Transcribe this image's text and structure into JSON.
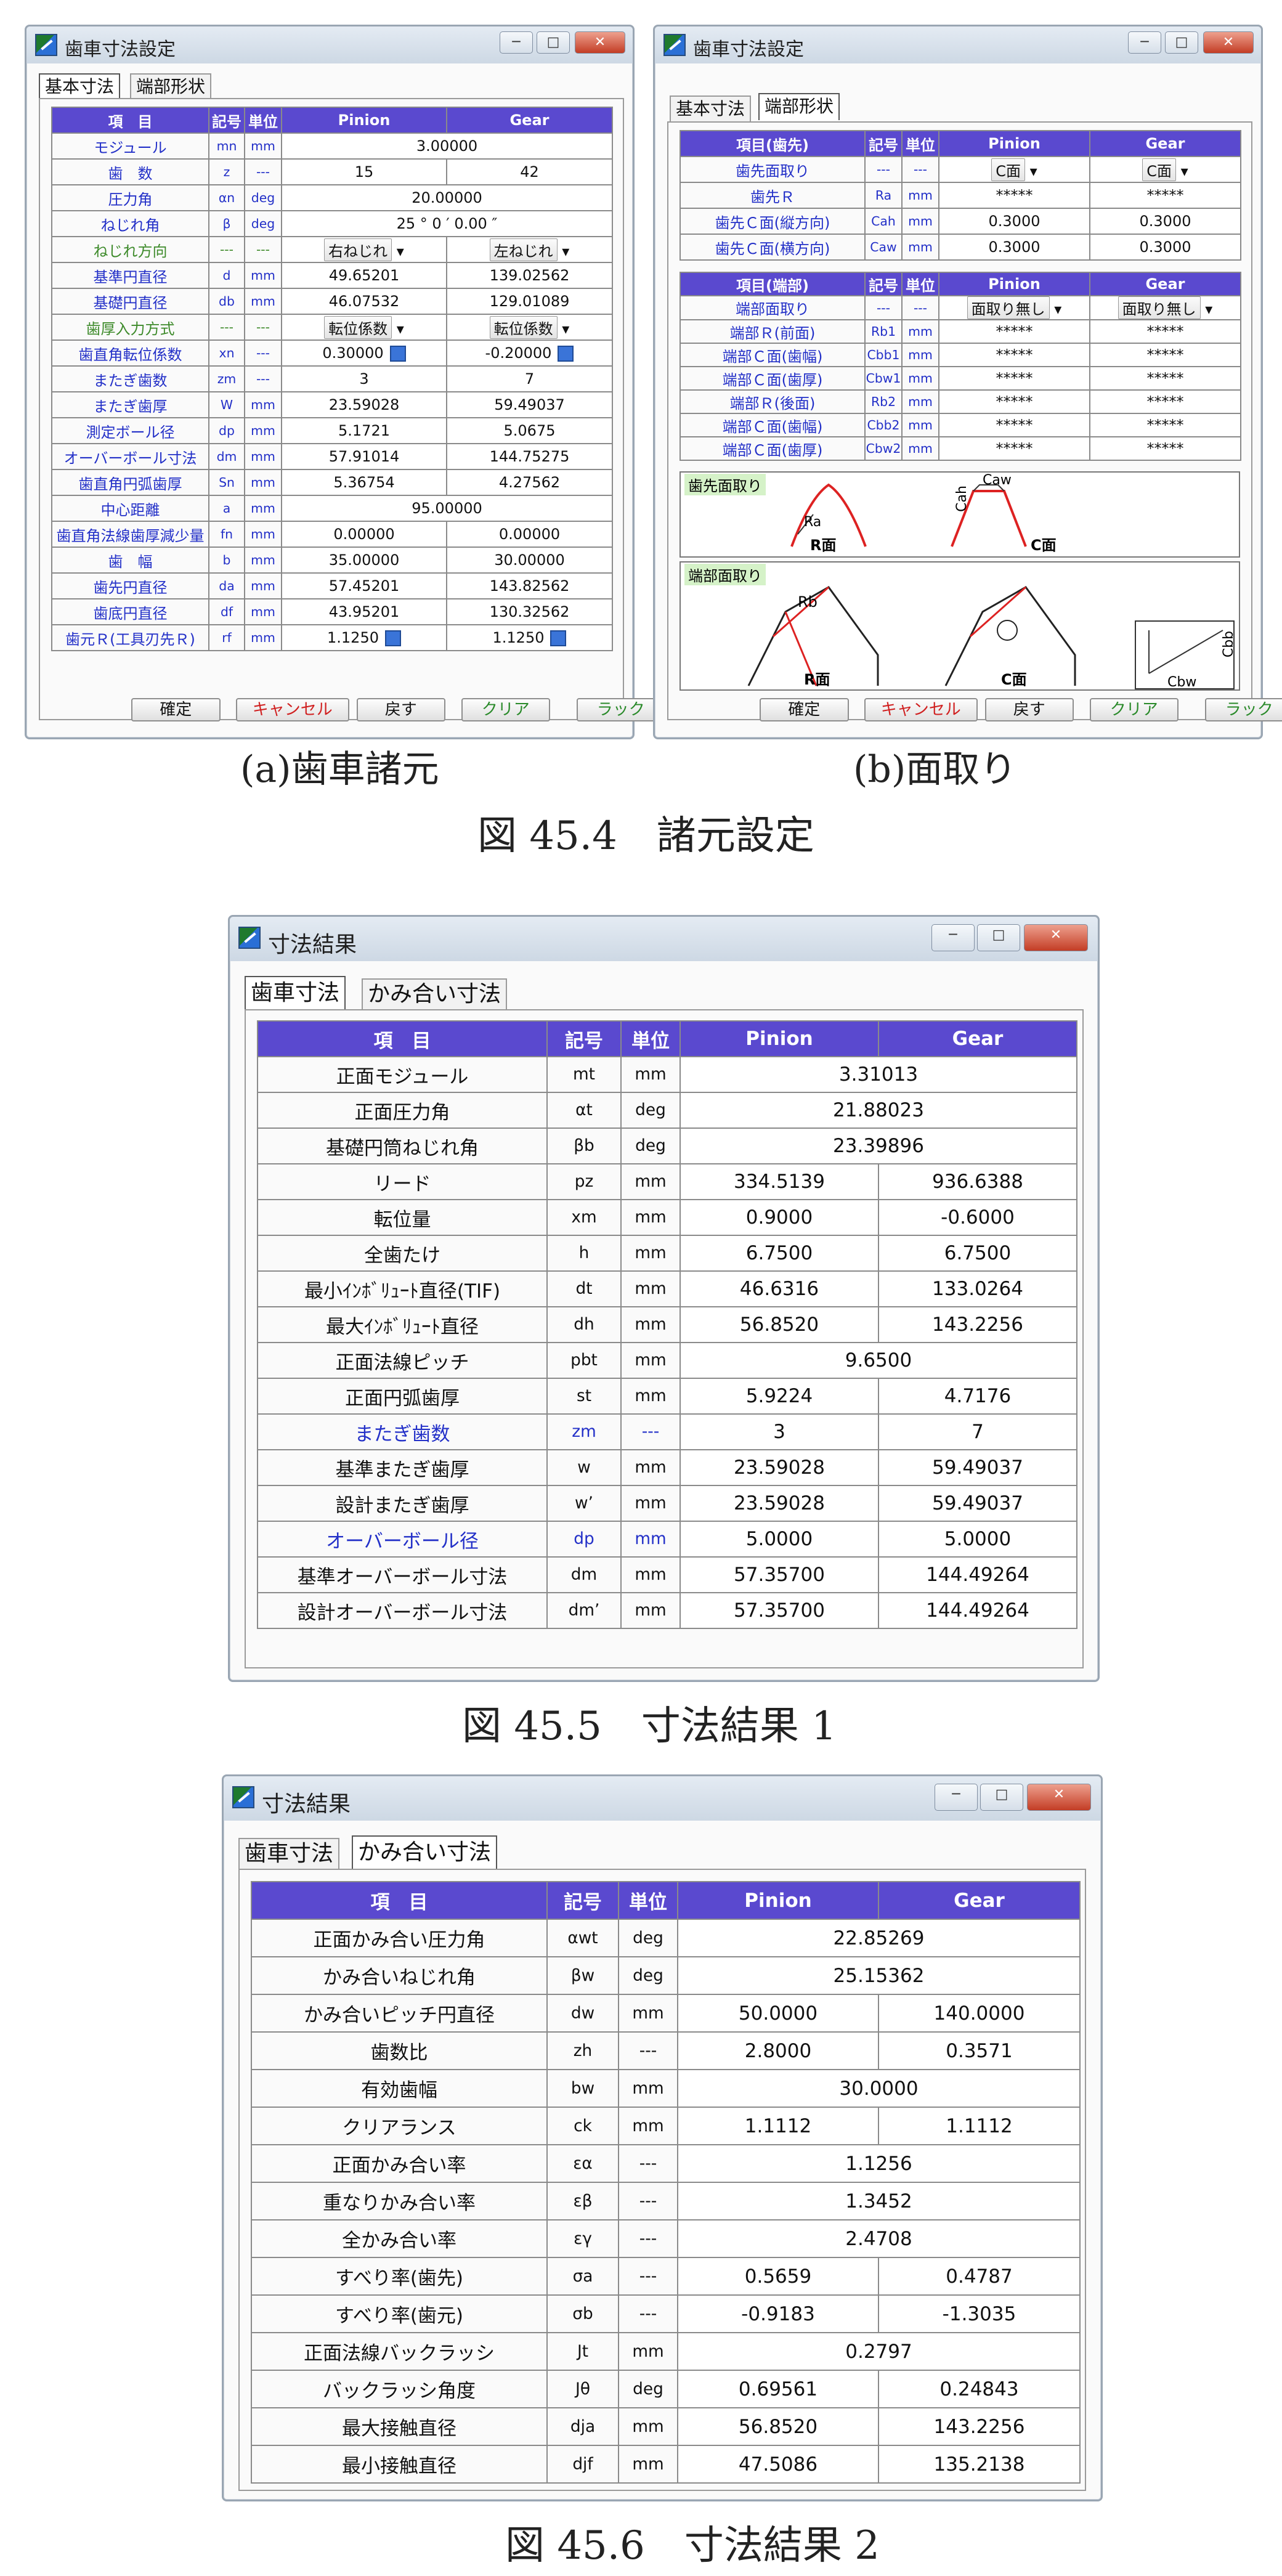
{
  "win_a": {
    "title": "歯車寸法設定",
    "tabs": [
      "基本寸法",
      "端部形状"
    ],
    "headers": [
      "項　目",
      "記号",
      "単位",
      "Pinion",
      "Gear"
    ],
    "rows": [
      [
        "モジュール",
        "mn",
        "mm",
        "3.00000",
        ""
      ],
      [
        "歯　数",
        "z",
        "---",
        "15",
        "42"
      ],
      [
        "圧力角",
        "αn",
        "deg",
        "20.00000",
        ""
      ],
      [
        "ねじれ角",
        "β",
        "deg",
        "25 ° 0 ′ 0.00 ″",
        ""
      ],
      [
        "ねじれ方向",
        "---",
        "---",
        "右ねじれ",
        "左ねじれ"
      ],
      [
        "基準円直径",
        "d",
        "mm",
        "49.65201",
        "139.02562"
      ],
      [
        "基礎円直径",
        "db",
        "mm",
        "46.07532",
        "129.01089"
      ],
      [
        "歯厚入力方式",
        "---",
        "---",
        "転位係数",
        "転位係数"
      ],
      [
        "歯直角転位係数",
        "xn",
        "---",
        "0.30000",
        "-0.20000"
      ],
      [
        "またぎ歯数",
        "zm",
        "---",
        "3",
        "7"
      ],
      [
        "またぎ歯厚",
        "W",
        "mm",
        "23.59028",
        "59.49037"
      ],
      [
        "測定ボール径",
        "dp",
        "mm",
        "5.1721",
        "5.0675"
      ],
      [
        "オーバーボール寸法",
        "dm",
        "mm",
        "57.91014",
        "144.75275"
      ],
      [
        "歯直角円弧歯厚",
        "Sn",
        "mm",
        "5.36754",
        "4.27562"
      ],
      [
        "中心距離",
        "a",
        "mm",
        "95.00000",
        ""
      ],
      [
        "歯直角法線歯厚減少量",
        "fn",
        "mm",
        "0.00000",
        "0.00000"
      ],
      [
        "歯　幅",
        "b",
        "mm",
        "35.00000",
        "30.00000"
      ],
      [
        "歯先円直径",
        "da",
        "mm",
        "57.45201",
        "143.82562"
      ],
      [
        "歯底円直径",
        "df",
        "mm",
        "43.95201",
        "130.32562"
      ],
      [
        "歯元Ｒ(工具刃先Ｒ)",
        "rf",
        "mm",
        "1.1250",
        "1.1250"
      ]
    ],
    "buttons": [
      "確定",
      "キャンセル",
      "戻す",
      "クリア",
      "ラック"
    ]
  },
  "win_b": {
    "title": "歯車寸法設定",
    "tabs": [
      "基本寸法",
      "端部形状"
    ],
    "headers1": [
      "項目(歯先)",
      "記号",
      "単位",
      "Pinion",
      "Gear"
    ],
    "rows1": [
      [
        "歯先面取り",
        "---",
        "---",
        "C面",
        "C面"
      ],
      [
        "歯先Ｒ",
        "Ra",
        "mm",
        "*****",
        "*****"
      ],
      [
        "歯先Ｃ面(縦方向)",
        "Cah",
        "mm",
        "0.3000",
        "0.3000"
      ],
      [
        "歯先Ｃ面(横方向)",
        "Caw",
        "mm",
        "0.3000",
        "0.3000"
      ]
    ],
    "headers2": [
      "項目(端部)",
      "記号",
      "単位",
      "Pinion",
      "Gear"
    ],
    "rows2": [
      [
        "端部面取り",
        "---",
        "---",
        "面取り無し",
        "面取り無し"
      ],
      [
        "端部Ｒ(前面)",
        "Rb1",
        "mm",
        "*****",
        "*****"
      ],
      [
        "端部Ｃ面(歯幅)",
        "Cbb1",
        "mm",
        "*****",
        "*****"
      ],
      [
        "端部Ｃ面(歯厚)",
        "Cbw1",
        "mm",
        "*****",
        "*****"
      ],
      [
        "端部Ｒ(後面)",
        "Rb2",
        "mm",
        "*****",
        "*****"
      ],
      [
        "端部Ｃ面(歯幅)",
        "Cbb2",
        "mm",
        "*****",
        "*****"
      ],
      [
        "端部Ｃ面(歯厚)",
        "Cbw2",
        "mm",
        "*****",
        "*****"
      ]
    ],
    "diag1": {
      "label": "歯先面取り",
      "r_face": "R面",
      "c_face": "C面",
      "ra": "Ra",
      "caw": "Caw",
      "cah": "Cah"
    },
    "diag2": {
      "label": "端部面取り",
      "rb": "Rb",
      "r_face": "R面",
      "c_face": "C面",
      "cbb": "Cbb",
      "cbw": "Cbw"
    },
    "buttons": [
      "確定",
      "キャンセル",
      "戻す",
      "クリア",
      "ラック"
    ]
  },
  "caption_a": "(a)歯車諸元",
  "caption_b": "(b)面取り",
  "fig1": "図 45.4　諸元設定",
  "win_c": {
    "title": "寸法結果",
    "tabs": [
      "歯車寸法",
      "かみ合い寸法"
    ],
    "headers": [
      "項　目",
      "記号",
      "単位",
      "Pinion",
      "Gear"
    ],
    "rows": [
      [
        "正面モジュール",
        "mt",
        "mm",
        "3.31013",
        ""
      ],
      [
        "正面圧力角",
        "αt",
        "deg",
        "21.88023",
        ""
      ],
      [
        "基礎円筒ねじれ角",
        "βb",
        "deg",
        "23.39896",
        ""
      ],
      [
        "リード",
        "pz",
        "mm",
        "334.5139",
        "936.6388"
      ],
      [
        "転位量",
        "xm",
        "mm",
        "0.9000",
        "-0.6000"
      ],
      [
        "全歯たけ",
        "h",
        "mm",
        "6.7500",
        "6.7500"
      ],
      [
        "最小ｲﾝﾎﾞﾘｭｰﾄ直径(TIF)",
        "dt",
        "mm",
        "46.6316",
        "133.0264"
      ],
      [
        "最大ｲﾝﾎﾞﾘｭｰﾄ直径",
        "dh",
        "mm",
        "56.8520",
        "143.2256"
      ],
      [
        "正面法線ピッチ",
        "pbt",
        "mm",
        "9.6500",
        ""
      ],
      [
        "正面円弧歯厚",
        "st",
        "mm",
        "5.9224",
        "4.7176"
      ],
      [
        "またぎ歯数",
        "zm",
        "---",
        "3",
        "7"
      ],
      [
        "基準またぎ歯厚",
        "w",
        "mm",
        "23.59028",
        "59.49037"
      ],
      [
        "設計またぎ歯厚",
        "w’",
        "mm",
        "23.59028",
        "59.49037"
      ],
      [
        "オーバーボール径",
        "dp",
        "mm",
        "5.0000",
        "5.0000"
      ],
      [
        "基準オーバーボール寸法",
        "dm",
        "mm",
        "57.35700",
        "144.49264"
      ],
      [
        "設計オーバーボール寸法",
        "dm’",
        "mm",
        "57.35700",
        "144.49264"
      ]
    ]
  },
  "fig2": "図 45.5　寸法結果 1",
  "win_d": {
    "title": "寸法結果",
    "tabs": [
      "歯車寸法",
      "かみ合い寸法"
    ],
    "headers": [
      "項　目",
      "記号",
      "単位",
      "Pinion",
      "Gear"
    ],
    "rows": [
      [
        "正面かみ合い圧力角",
        "αwt",
        "deg",
        "22.85269",
        ""
      ],
      [
        "かみ合いねじれ角",
        "βw",
        "deg",
        "25.15362",
        ""
      ],
      [
        "かみ合いピッチ円直径",
        "dw",
        "mm",
        "50.0000",
        "140.0000"
      ],
      [
        "歯数比",
        "zh",
        "---",
        "2.8000",
        "0.3571"
      ],
      [
        "有効歯幅",
        "bw",
        "mm",
        "30.0000",
        ""
      ],
      [
        "クリアランス",
        "ck",
        "mm",
        "1.1112",
        "1.1112"
      ],
      [
        "正面かみ合い率",
        "εα",
        "---",
        "1.1256",
        ""
      ],
      [
        "重なりかみ合い率",
        "εβ",
        "---",
        "1.3452",
        ""
      ],
      [
        "全かみ合い率",
        "εγ",
        "---",
        "2.4708",
        ""
      ],
      [
        "すべり率(歯先)",
        "σa",
        "---",
        "0.5659",
        "0.4787"
      ],
      [
        "すべり率(歯元)",
        "σb",
        "---",
        "-0.9183",
        "-1.3035"
      ],
      [
        "正面法線バックラッシ",
        "Jt",
        "mm",
        "0.2797",
        ""
      ],
      [
        "バックラッシ角度",
        "Jθ",
        "deg",
        "0.69561",
        "0.24843"
      ],
      [
        "最大接触直径",
        "dja",
        "mm",
        "56.8520",
        "143.2256"
      ],
      [
        "最小接触直径",
        "djf",
        "mm",
        "47.5086",
        "135.2138"
      ]
    ]
  },
  "fig3": "図 45.6　寸法結果 2",
  "colors": {
    "header": "#5a49cf",
    "blue_text": "#2330c8",
    "green_text": "#3d8a2a",
    "check": "#3a74d8",
    "red_button": "#d02020",
    "green_button": "#2a8a2a"
  }
}
